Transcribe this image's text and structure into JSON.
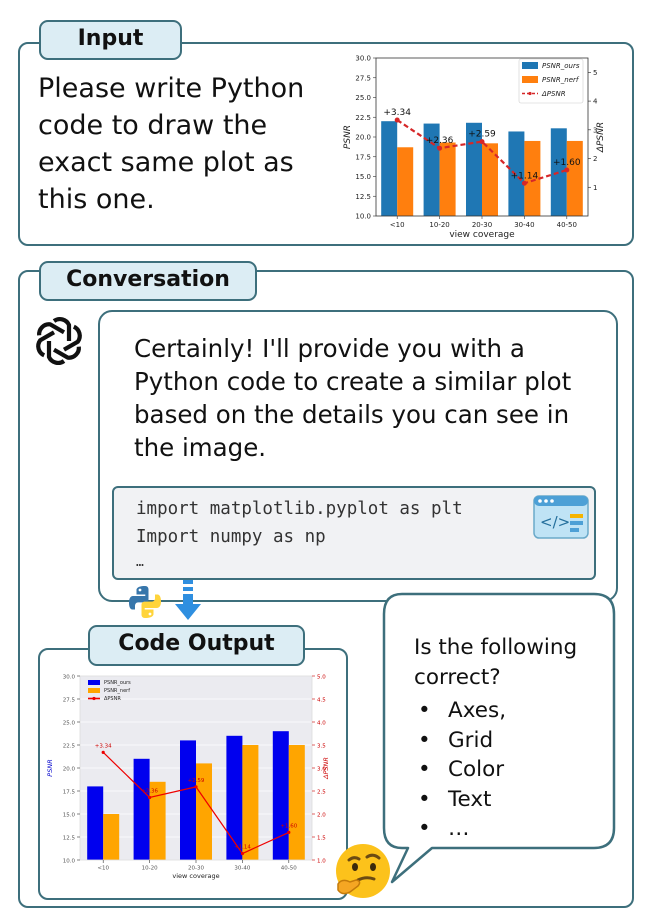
{
  "input": {
    "tab_label": "Input",
    "prompt": "Please write Python code to draw the exact same plot as this one."
  },
  "conversation": {
    "tab_label": "Conversation",
    "assistant_message": "Certainly! I'll provide you with a Python code to create a similar plot based on the details you can see in the image.",
    "code_lines": [
      "import matplotlib.pyplot as plt",
      "Import numpy as np",
      "…"
    ]
  },
  "code_output": {
    "tab_label": "Code Output"
  },
  "question": {
    "text": "Is the following correct?",
    "items": [
      "Axes,",
      "Grid",
      "Color",
      "Text",
      "…"
    ]
  },
  "icons": [
    "chatgpt-logo-icon",
    "code-window-icon",
    "python-logo-icon",
    "down-arrow-icon",
    "thinking-face-emoji-icon"
  ],
  "colors": {
    "border": "#3d6f7c",
    "tab_fill": "#dcedf4",
    "code_bg": "#f1f2f4"
  },
  "chart_data": [
    {
      "type": "bar",
      "categories": [
        "<10",
        "10-20",
        "20-30",
        "30-40",
        "40-50"
      ],
      "series": [
        {
          "name": "PSNR_ours",
          "values": [
            22.0,
            21.7,
            21.8,
            20.7,
            21.1
          ],
          "color": "#1f77b4"
        },
        {
          "name": "PSNR_nerf",
          "values": [
            18.7,
            19.3,
            19.2,
            19.5,
            19.5
          ],
          "color": "#ff7f0e"
        },
        {
          "name": "ΔPSNR",
          "values": [
            3.34,
            2.36,
            2.59,
            1.14,
            1.6
          ],
          "color": "#d62728",
          "axis": "right",
          "style": "dashed-line"
        }
      ],
      "data_labels": [
        "+3.34",
        "+2.36",
        "+2.59",
        "+1.14",
        "+1.60"
      ],
      "xlabel": "view coverage",
      "ylabel": "PSNR",
      "ylabel_right": "ΔPSNR",
      "ylim": [
        10.0,
        30.0
      ],
      "ylim_right": [
        0,
        5.5
      ],
      "yticks": [
        "10.0",
        "12.5",
        "15.0",
        "17.5",
        "20.0",
        "22.5",
        "25.0",
        "27.5",
        "30.0"
      ],
      "yticks_right": [
        "1",
        "2",
        "3",
        "4",
        "5"
      ],
      "legend_position": "top-right",
      "grid": false
    },
    {
      "type": "bar",
      "categories": [
        "<10",
        "10-20",
        "20-30",
        "30-40",
        "40-50"
      ],
      "series": [
        {
          "name": "PSNR_ours",
          "values": [
            18.0,
            21.0,
            23.0,
            23.5,
            24.0
          ],
          "color": "#0000ee"
        },
        {
          "name": "PSNR_nerf",
          "values": [
            15.0,
            18.5,
            20.5,
            22.5,
            22.5
          ],
          "color": "#ffa500"
        },
        {
          "name": "ΔPSNR",
          "values": [
            3.34,
            2.36,
            2.59,
            1.14,
            1.6
          ],
          "color": "#ee0000",
          "axis": "right",
          "style": "solid-line"
        }
      ],
      "data_labels": [
        "+3.34",
        "+2.36",
        "+2.59",
        "+1.14",
        "+1.60"
      ],
      "xlabel": "view coverage",
      "ylabel": "PSNR",
      "ylabel_right": "ΔPSNR",
      "ylim": [
        10.0,
        30.0
      ],
      "ylim_right": [
        1.0,
        5.0
      ],
      "yticks": [
        "10.0",
        "12.5",
        "15.0",
        "17.5",
        "20.0",
        "22.5",
        "25.0",
        "27.5",
        "30.0"
      ],
      "yticks_right": [
        "1.0",
        "1.5",
        "2.0",
        "2.5",
        "3.0",
        "3.5",
        "4.0",
        "4.5",
        "5.0"
      ],
      "legend_position": "top-left",
      "grid": true
    }
  ]
}
